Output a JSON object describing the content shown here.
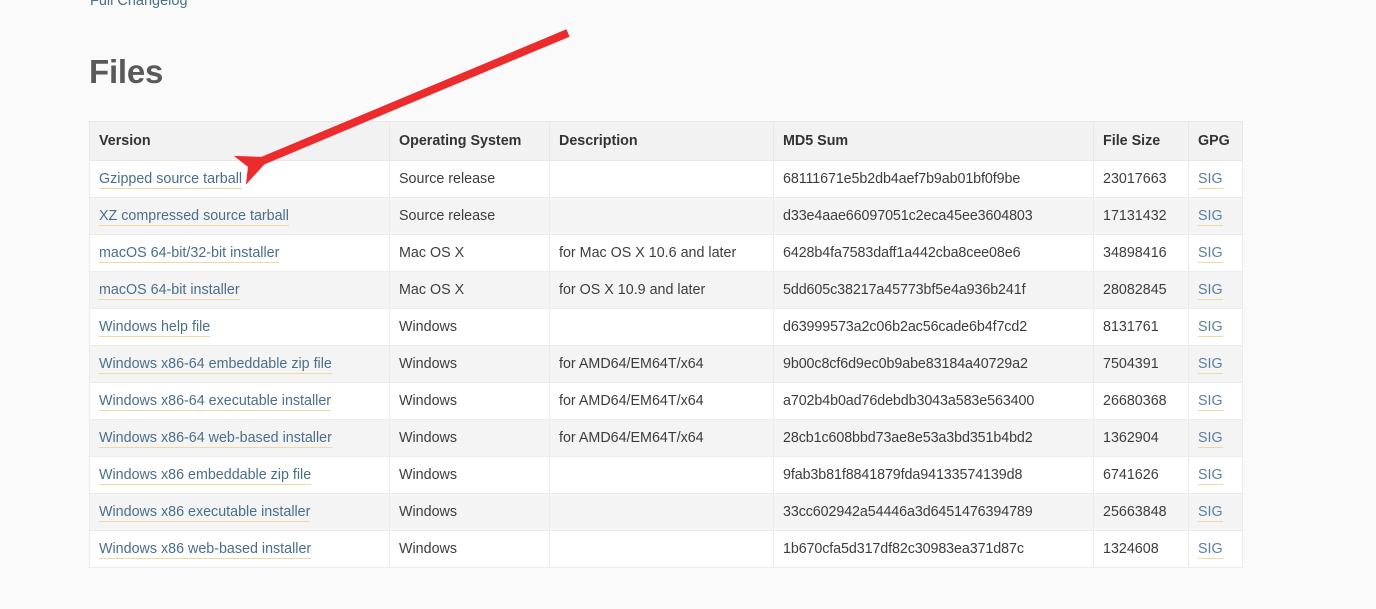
{
  "page": {
    "changelog_link": "Full Changelog",
    "heading": "Files"
  },
  "table": {
    "columns": [
      "Version",
      "Operating System",
      "Description",
      "MD5 Sum",
      "File Size",
      "GPG"
    ],
    "gpg_label": "SIG",
    "rows": [
      {
        "version": "Gzipped source tarball",
        "os": "Source release",
        "description": "",
        "md5": "68111671e5b2db4aef7b9ab01bf0f9be",
        "size": "23017663",
        "gpg": "SIG"
      },
      {
        "version": "XZ compressed source tarball",
        "os": "Source release",
        "description": "",
        "md5": "d33e4aae66097051c2eca45ee3604803",
        "size": "17131432",
        "gpg": "SIG"
      },
      {
        "version": "macOS 64-bit/32-bit installer",
        "os": "Mac OS X",
        "description": "for Mac OS X 10.6 and later",
        "md5": "6428b4fa7583daff1a442cba8cee08e6",
        "size": "34898416",
        "gpg": "SIG"
      },
      {
        "version": "macOS 64-bit installer",
        "os": "Mac OS X",
        "description": "for OS X 10.9 and later",
        "md5": "5dd605c38217a45773bf5e4a936b241f",
        "size": "28082845",
        "gpg": "SIG"
      },
      {
        "version": "Windows help file",
        "os": "Windows",
        "description": "",
        "md5": "d63999573a2c06b2ac56cade6b4f7cd2",
        "size": "8131761",
        "gpg": "SIG"
      },
      {
        "version": "Windows x86-64 embeddable zip file",
        "os": "Windows",
        "description": "for AMD64/EM64T/x64",
        "md5": "9b00c8cf6d9ec0b9abe83184a40729a2",
        "size": "7504391",
        "gpg": "SIG"
      },
      {
        "version": "Windows x86-64 executable installer",
        "os": "Windows",
        "description": "for AMD64/EM64T/x64",
        "md5": "a702b4b0ad76debdb3043a583e563400",
        "size": "26680368",
        "gpg": "SIG"
      },
      {
        "version": "Windows x86-64 web-based installer",
        "os": "Windows",
        "description": "for AMD64/EM64T/x64",
        "md5": "28cb1c608bbd73ae8e53a3bd351b4bd2",
        "size": "1362904",
        "gpg": "SIG"
      },
      {
        "version": "Windows x86 embeddable zip file",
        "os": "Windows",
        "description": "",
        "md5": "9fab3b81f8841879fda94133574139d8",
        "size": "6741626",
        "gpg": "SIG"
      },
      {
        "version": "Windows x86 executable installer",
        "os": "Windows",
        "description": "",
        "md5": "33cc602942a54446a3d6451476394789",
        "size": "25663848",
        "gpg": "SIG"
      },
      {
        "version": "Windows x86 web-based installer",
        "os": "Windows",
        "description": "",
        "md5": "1b670cfa5d317df82c30983ea371d87c",
        "size": "1324608",
        "gpg": "SIG"
      }
    ]
  },
  "annotation": {
    "arrow_color": "#ec2c2c",
    "points_at": "Gzipped source tarball"
  }
}
